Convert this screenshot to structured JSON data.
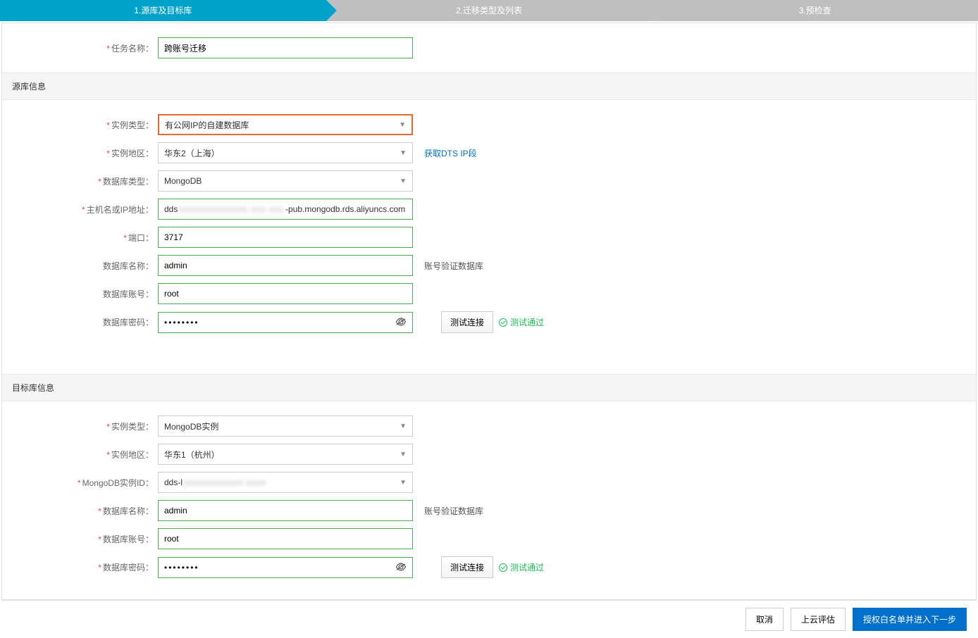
{
  "steps": {
    "s1": "1.源库及目标库",
    "s2": "2.迁移类型及列表",
    "s3": "3.预检查"
  },
  "task": {
    "label": "任务名称",
    "value": "跨账号迁移"
  },
  "source": {
    "header": "源库信息",
    "instance_type_label": "实例类型",
    "instance_type_value": "有公网IP的自建数据库",
    "region_label": "实例地区",
    "region_value": "华东2（上海）",
    "get_ip_link": "获取DTS IP段",
    "db_type_label": "数据库类型",
    "db_type_value": "MongoDB",
    "host_label": "主机名或IP地址",
    "host_prefix": "dds",
    "host_mask": "xxxxxxxxxxxxxx xxx xxx",
    "host_suffix": "-pub.mongodb.rds.aliyuncs.com",
    "port_label": "端口",
    "port_value": "3717",
    "dbname_label": "数据库名称",
    "dbname_value": "admin",
    "dbname_side": "账号验证数据库",
    "account_label": "数据库账号",
    "account_value": "root",
    "password_label": "数据库密码",
    "password_value": "••••••••",
    "test_btn": "测试连接",
    "test_pass": "测试通过"
  },
  "target": {
    "header": "目标库信息",
    "instance_type_label": "实例类型",
    "instance_type_value": "MongoDB实例",
    "region_label": "实例地区",
    "region_value": "华东1（杭州）",
    "instance_id_label": "MongoDB实例ID",
    "instance_id_prefix": "dds-l",
    "instance_id_mask": "xxxxxxxxxxxx xxxx",
    "dbname_label": "数据库名称",
    "dbname_value": "admin",
    "dbname_side": "账号验证数据库",
    "account_label": "数据库账号",
    "account_value": "root",
    "password_label": "数据库密码",
    "password_value": "••••••••",
    "test_btn": "测试连接",
    "test_pass": "测试通过"
  },
  "footer": {
    "cancel": "取消",
    "cloud": "上云评估",
    "next": "授权白名单并进入下一步"
  },
  "glyph": {
    "caret": "▼",
    "eye": "👁",
    "colon": "："
  }
}
